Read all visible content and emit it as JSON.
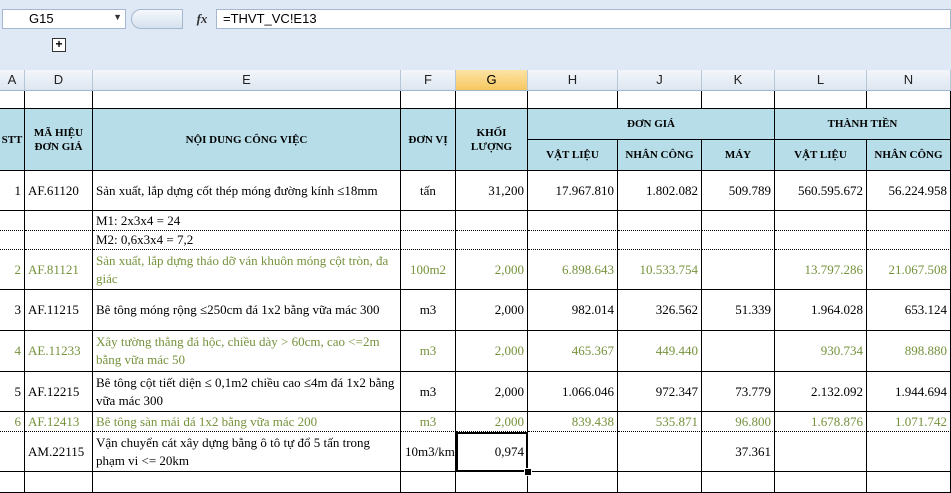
{
  "formula_bar": {
    "name_box": "G15",
    "fx_label": "fx",
    "formula": "=THVT_VC!E13"
  },
  "group_bar": {
    "expand_label": "+"
  },
  "columns": [
    "A",
    "D",
    "E",
    "F",
    "G",
    "H",
    "J",
    "K",
    "L",
    "N"
  ],
  "headers": {
    "stt": "STT",
    "ma_hieu": "MÃ HIỆU ĐƠN GIÁ",
    "noi_dung": "NỘI DUNG CÔNG VIỆC",
    "don_vi": "ĐƠN VỊ",
    "khoi_luong": "KHỐI LƯỢNG",
    "don_gia": "ĐƠN GIÁ",
    "thanh_tien": "THÀNH TIỀN",
    "vat_lieu": "VẬT LIỆU",
    "nhan_cong": "NHÂN CÔNG",
    "may": "MÁY",
    "vat_lieu2": "VẬT LIỆU",
    "nhan_cong2": "NHÂN CÔNG"
  },
  "rows": [
    {
      "stt": "1",
      "code": "AF.61120",
      "desc": "Sản xuất, lắp dựng cốt thép móng đường kính ≤18mm",
      "unit": "tấn",
      "qty": "31,200",
      "vl": "17.967.810",
      "nc": "1.802.082",
      "may": "509.789",
      "tvl": "560.595.672",
      "tnc": "56.224.958"
    },
    {
      "desc": "M1: 2x3x4 = 24"
    },
    {
      "desc": "M2: 0,6x3x4 = 7,2"
    },
    {
      "stt": "2",
      "code": "AF.81121",
      "desc": "Sản xuất, lắp dựng tháo dỡ ván khuôn móng cột tròn, đa giác",
      "unit": "100m2",
      "qty": "2,000",
      "vl": "6.898.643",
      "nc": "10.533.754",
      "may": "",
      "tvl": "13.797.286",
      "tnc": "21.067.508"
    },
    {
      "stt": "3",
      "code": "AF.11215",
      "desc": "Bê tông móng rộng ≤250cm đá 1x2 bằng vữa mác 300",
      "unit": "m3",
      "qty": "2,000",
      "vl": "982.014",
      "nc": "326.562",
      "may": "51.339",
      "tvl": "1.964.028",
      "tnc": "653.124"
    },
    {
      "stt": "4",
      "code": "AE.11233",
      "desc": "Xây tường thẳng đá hộc, chiều dày > 60cm, cao <=2m bằng vữa mác 50",
      "unit": "m3",
      "qty": "2,000",
      "vl": "465.367",
      "nc": "449.440",
      "may": "",
      "tvl": "930.734",
      "tnc": "898.880"
    },
    {
      "stt": "5",
      "code": "AF.12215",
      "desc": "Bê tông cột tiết diện ≤ 0,1m2 chiều cao ≤4m đá 1x2 bằng vữa mác 300",
      "unit": "m3",
      "qty": "2,000",
      "vl": "1.066.046",
      "nc": "972.347",
      "may": "73.779",
      "tvl": "2.132.092",
      "tnc": "1.944.694"
    },
    {
      "stt": "6",
      "code": "AF.12413",
      "desc": "Bê tông sàn mái đá 1x2 bằng vữa mác 200",
      "unit": "m3",
      "qty": "2,000",
      "vl": "839.438",
      "nc": "535.871",
      "may": "96.800",
      "tvl": "1.678.876",
      "tnc": "1.071.742"
    },
    {
      "stt": "",
      "code": "AM.22115",
      "desc": "Vận chuyển cát xây dựng bằng ô tô tự đổ 5 tấn trong phạm vi <= 20km",
      "unit": "10m3/km",
      "qty": "0,974",
      "vl": "",
      "nc": "",
      "may": "37.361",
      "tvl": "",
      "tnc": ""
    }
  ]
}
